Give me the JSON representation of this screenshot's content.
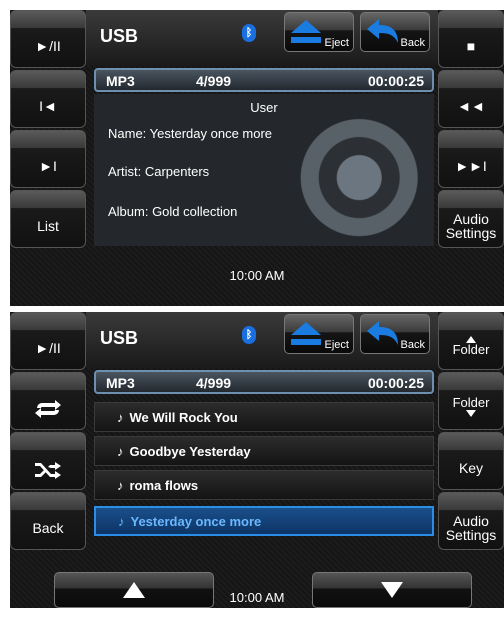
{
  "screen1": {
    "left_buttons": [
      "►/II",
      "I◄",
      "►I",
      "List"
    ],
    "right_buttons": [
      "■",
      "◄◄",
      "►►I",
      "Audio Settings"
    ],
    "title": "USB",
    "bluetooth_symbol": "ᛒ",
    "eject_label": "Eject",
    "back_label": "Back",
    "format": "MP3",
    "track": "4/999",
    "time": "00:00:25",
    "heading": "User",
    "name": "Name: Yesterday once more",
    "artist": "Artist: Carpenters",
    "album": "Album: Gold collection",
    "clock": "10:00 AM"
  },
  "screen2": {
    "left_buttons": [
      "►/II",
      "repeat-icon",
      "shuffle-icon",
      "Back"
    ],
    "right_buttons": [
      "Folder",
      "Folder",
      "Key",
      "Audio Settings"
    ],
    "title": "USB",
    "bluetooth_symbol": "ᛒ",
    "eject_label": "Eject",
    "back_label": "Back",
    "format": "MP3",
    "track": "4/999",
    "time": "00:00:25",
    "tracks": [
      "We Will Rock You",
      "Goodbye Yesterday",
      "roma flows",
      "Yesterday once more"
    ],
    "selected_index": 3,
    "clock": "10:00 AM"
  },
  "colors": {
    "accent_blue": "#2a8ee8",
    "selected_text": "#6bb8ff",
    "bluetooth": "#1a6fe0"
  }
}
